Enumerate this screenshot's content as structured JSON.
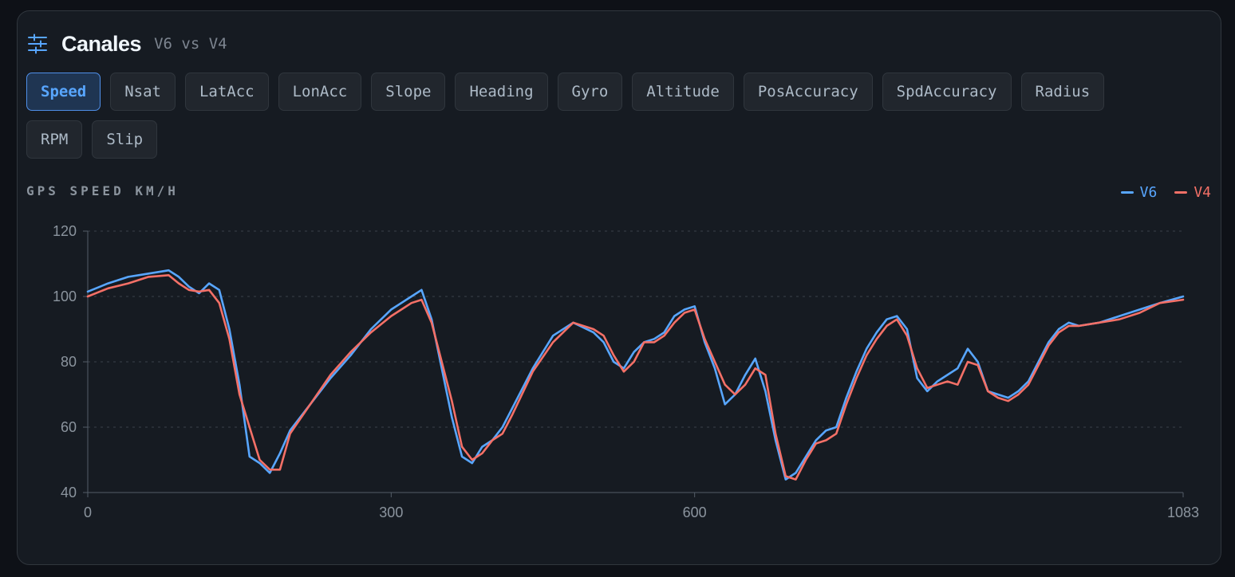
{
  "header": {
    "title": "Canales",
    "subtitle": "V6 vs V4",
    "icon": "sliders-icon"
  },
  "channels": [
    {
      "label": "Speed",
      "active": true
    },
    {
      "label": "Nsat"
    },
    {
      "label": "LatAcc"
    },
    {
      "label": "LonAcc"
    },
    {
      "label": "Slope"
    },
    {
      "label": "Heading"
    },
    {
      "label": "Gyro"
    },
    {
      "label": "Altitude"
    },
    {
      "label": "PosAccuracy"
    },
    {
      "label": "SpdAccuracy"
    },
    {
      "label": "Radius"
    },
    {
      "label": "RPM"
    },
    {
      "label": "Slip"
    }
  ],
  "colors": {
    "v6": "#58a6ff",
    "v4": "#f47067",
    "accent": "#58a6ff"
  },
  "chart_data": {
    "type": "line",
    "title": "GPS SPEED KM/H",
    "xlim": [
      0,
      1083
    ],
    "ylim": [
      40,
      120
    ],
    "xticks": [
      0,
      300,
      600,
      1083
    ],
    "yticks": [
      40,
      60,
      80,
      100,
      120
    ],
    "grid": true,
    "legend_position": "top-right",
    "series": [
      {
        "name": "V6",
        "color": "#58a6ff",
        "x": [
          0,
          20,
          40,
          60,
          80,
          90,
          100,
          110,
          120,
          130,
          140,
          150,
          160,
          170,
          180,
          190,
          200,
          220,
          240,
          260,
          280,
          300,
          320,
          330,
          340,
          350,
          360,
          370,
          380,
          390,
          400,
          410,
          420,
          440,
          460,
          480,
          500,
          510,
          520,
          530,
          540,
          550,
          560,
          570,
          580,
          590,
          600,
          610,
          620,
          630,
          640,
          650,
          660,
          670,
          680,
          690,
          700,
          710,
          720,
          730,
          740,
          750,
          760,
          770,
          780,
          790,
          800,
          810,
          820,
          830,
          840,
          850,
          860,
          870,
          880,
          890,
          900,
          910,
          920,
          930,
          940,
          950,
          960,
          970,
          980,
          1000,
          1020,
          1040,
          1060,
          1083
        ],
        "y": [
          101.5,
          104,
          106,
          107,
          108,
          106,
          103,
          101,
          104,
          102,
          90,
          73,
          51,
          49,
          46,
          52,
          59,
          67,
          75,
          82,
          90,
          96,
          100,
          102,
          93,
          78,
          63,
          51,
          49,
          54,
          56,
          60,
          66,
          78,
          88,
          92,
          89,
          86,
          80,
          78,
          83,
          86,
          87,
          89,
          94,
          96,
          97,
          86,
          78,
          67,
          70,
          76,
          81,
          71,
          56,
          44,
          46,
          51,
          56,
          59,
          60,
          69,
          77,
          84,
          89,
          93,
          94,
          90,
          75,
          71,
          74,
          76,
          78,
          84,
          80,
          71,
          70,
          69,
          71,
          74,
          80,
          86,
          90,
          92,
          91,
          92,
          94,
          96,
          98,
          100
        ]
      },
      {
        "name": "V4",
        "color": "#f47067",
        "x": [
          0,
          20,
          40,
          60,
          80,
          90,
          100,
          110,
          120,
          130,
          140,
          150,
          160,
          170,
          180,
          190,
          200,
          220,
          240,
          260,
          280,
          300,
          320,
          330,
          340,
          350,
          360,
          370,
          380,
          390,
          400,
          410,
          420,
          440,
          460,
          480,
          500,
          510,
          520,
          530,
          540,
          550,
          560,
          570,
          580,
          590,
          600,
          610,
          620,
          630,
          640,
          650,
          660,
          670,
          680,
          690,
          700,
          710,
          720,
          730,
          740,
          750,
          760,
          770,
          780,
          790,
          800,
          810,
          820,
          830,
          840,
          850,
          860,
          870,
          880,
          890,
          900,
          910,
          920,
          930,
          940,
          950,
          960,
          970,
          980,
          1000,
          1020,
          1040,
          1060,
          1083
        ],
        "y": [
          100,
          102.5,
          104,
          106,
          106.5,
          104,
          102,
          101.5,
          102,
          98,
          87,
          70,
          60,
          50,
          47,
          47,
          58,
          67,
          76,
          83,
          89,
          94,
          98,
          99,
          92,
          80,
          68,
          54,
          50,
          52,
          56,
          58,
          64,
          77,
          86,
          92,
          90,
          88,
          82,
          77,
          80,
          86,
          86,
          88,
          92,
          95,
          96,
          87,
          80,
          73,
          70,
          73,
          78,
          76,
          58,
          45,
          44,
          50,
          55,
          56,
          58,
          67,
          75,
          82,
          87,
          91,
          93,
          88,
          78,
          72,
          73,
          74,
          73,
          80,
          79,
          71,
          69,
          68,
          70,
          73,
          79,
          85,
          89,
          91,
          91,
          92,
          93,
          95,
          98,
          99
        ]
      }
    ]
  }
}
